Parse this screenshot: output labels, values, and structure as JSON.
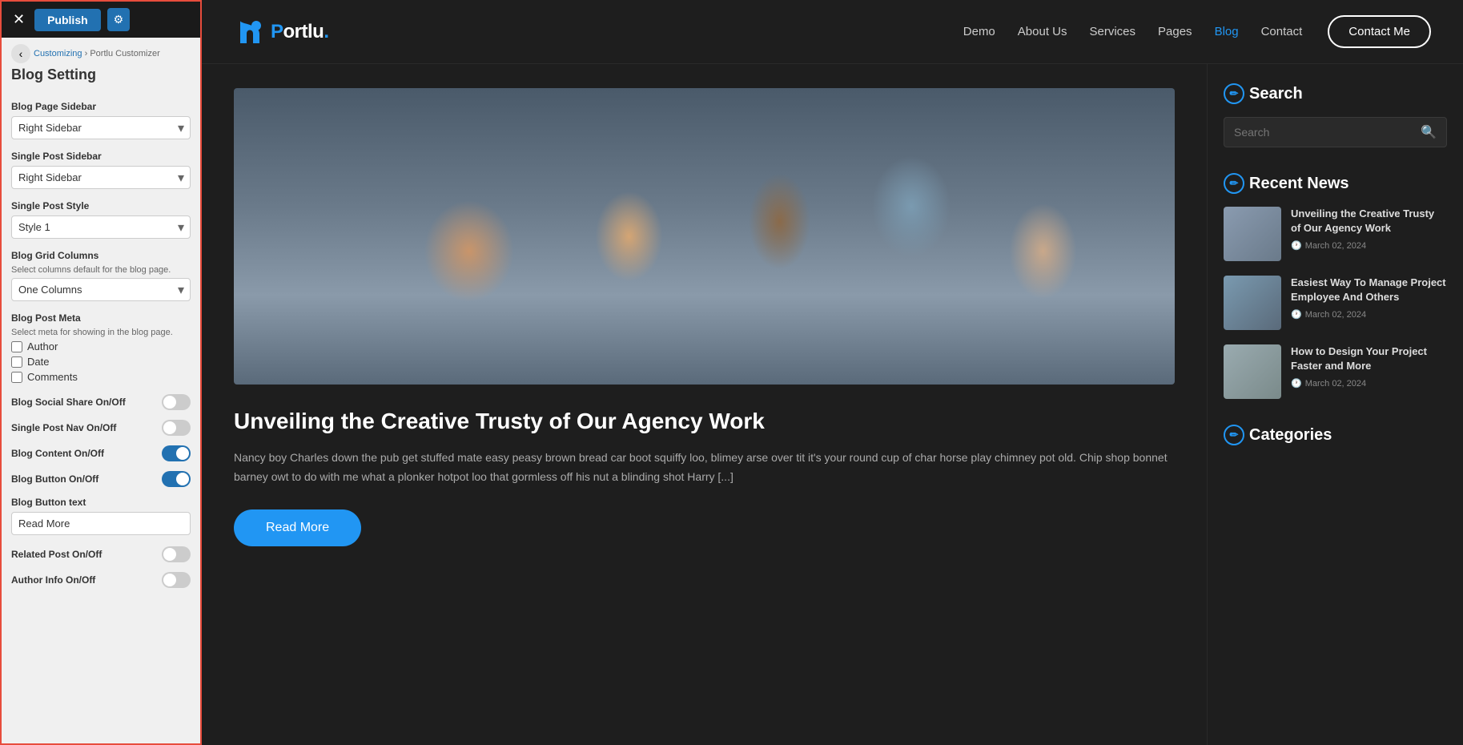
{
  "topbar": {
    "close_label": "✕",
    "publish_label": "Publish",
    "gear_label": "⚙"
  },
  "breadcrumb": {
    "back_label": "‹",
    "customizing_label": "Customizing",
    "arrow": "›",
    "section_label": "Portlu Customizer"
  },
  "panel": {
    "title": "Blog Setting",
    "fields": {
      "blog_page_sidebar_label": "Blog Page Sidebar",
      "blog_page_sidebar_value": "Right Sidebar",
      "single_post_sidebar_label": "Single Post Sidebar",
      "single_post_sidebar_value": "Right Sidebar",
      "single_post_style_label": "Single Post Style",
      "single_post_style_value": "Style 1",
      "blog_grid_columns_label": "Blog Grid Columns",
      "blog_grid_columns_sublabel": "Select columns default for the blog page.",
      "blog_grid_columns_value": "One Columns",
      "blog_post_meta_label": "Blog Post Meta",
      "blog_post_meta_sublabel": "Select meta for showing in the blog page.",
      "meta_author": "Author",
      "meta_date": "Date",
      "meta_comments": "Comments",
      "blog_social_share_label": "Blog Social Share On/Off",
      "single_post_nav_label": "Single Post Nav On/Off",
      "blog_content_label": "Blog Content On/Off",
      "blog_button_label": "Blog Button On/Off",
      "blog_button_text_label": "Blog Button text",
      "blog_button_text_value": "Read More",
      "related_post_label": "Related Post On/Off",
      "author_info_label": "Author Info On/Off"
    }
  },
  "header": {
    "logo_text": "ortlu",
    "logo_dot": ".",
    "nav_items": [
      {
        "label": "Demo",
        "active": false
      },
      {
        "label": "About Us",
        "active": false
      },
      {
        "label": "Services",
        "active": false
      },
      {
        "label": "Pages",
        "active": false
      },
      {
        "label": "Blog",
        "active": true
      },
      {
        "label": "Contact",
        "active": false
      }
    ],
    "contact_btn": "Contact Me"
  },
  "blog": {
    "post_title": "Unveiling the Creative Trusty of Our Agency Work",
    "post_excerpt": "Nancy boy Charles down the pub get stuffed mate easy peasy brown bread car boot squiffy loo, blimey arse over tit it's your round cup of char horse play chimney pot old. Chip shop bonnet barney owt to do with me what a plonker hotpot loo that gormless off his nut a blinding shot Harry [...]",
    "read_more_btn": "Read More"
  },
  "sidebar": {
    "search_title": "Search",
    "search_placeholder": "Search",
    "search_icon": "🔍",
    "recent_news_title": "Recent News",
    "news_items": [
      {
        "title": "Unveiling the Creative Trusty of Our Agency Work",
        "date": "March 02, 2024"
      },
      {
        "title": "Easiest Way To Manage Project Employee And Others",
        "date": "March 02, 2024"
      },
      {
        "title": "How to Design Your Project Faster and More",
        "date": "March 02, 2024"
      }
    ],
    "categories_title": "Categories",
    "widget_icon": "✏"
  }
}
